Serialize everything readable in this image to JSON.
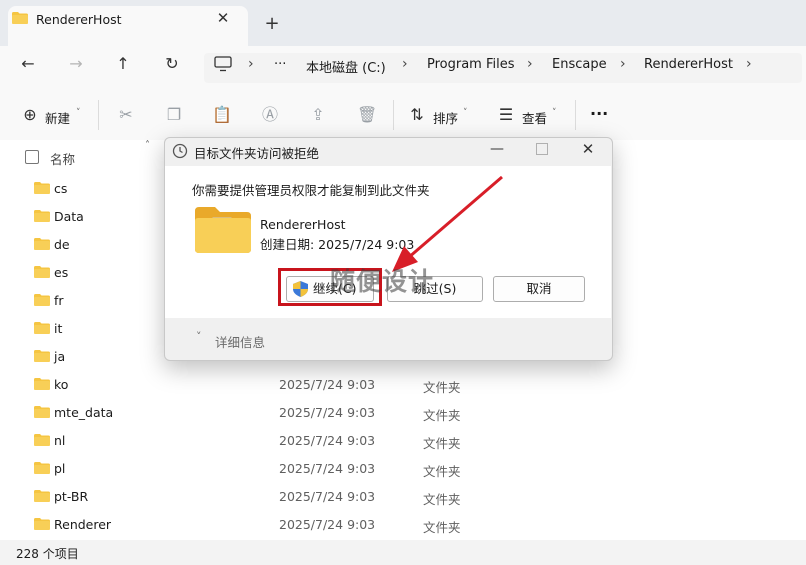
{
  "window": {
    "tab_title": "RendererHost",
    "close_glyph": "✕",
    "new_tab_glyph": "+"
  },
  "address_bar": {
    "overflow": "···",
    "crumbs": [
      "本地磁盘 (C:)",
      "Program Files",
      "Enscape",
      "RendererHost"
    ]
  },
  "toolbar": {
    "new_label": "新建",
    "sort_label": "排序",
    "view_label": "查看",
    "more": "···"
  },
  "list": {
    "name_header": "名称",
    "rows": [
      {
        "name": "cs",
        "date": "",
        "type": ""
      },
      {
        "name": "Data",
        "date": "",
        "type": ""
      },
      {
        "name": "de",
        "date": "",
        "type": ""
      },
      {
        "name": "es",
        "date": "",
        "type": ""
      },
      {
        "name": "fr",
        "date": "",
        "type": ""
      },
      {
        "name": "it",
        "date": "",
        "type": ""
      },
      {
        "name": "ja",
        "date": "",
        "type": ""
      },
      {
        "name": "ko",
        "date": "2025/7/24 9:03",
        "type": "文件夹"
      },
      {
        "name": "mte_data",
        "date": "2025/7/24 9:03",
        "type": "文件夹"
      },
      {
        "name": "nl",
        "date": "2025/7/24 9:03",
        "type": "文件夹"
      },
      {
        "name": "pl",
        "date": "2025/7/24 9:03",
        "type": "文件夹"
      },
      {
        "name": "pt-BR",
        "date": "2025/7/24 9:03",
        "type": "文件夹"
      },
      {
        "name": "Renderer",
        "date": "2025/7/24 9:03",
        "type": "文件夹"
      }
    ]
  },
  "status": {
    "item_count": "228 个项目"
  },
  "dialog": {
    "title": "目标文件夹访问被拒绝",
    "message": "你需要提供管理员权限才能复制到此文件夹",
    "file_name": "RendererHost",
    "file_created": "创建日期: 2025/7/24 9:03",
    "continue_label": "继续(C)",
    "skip_label": "跳过(S)",
    "cancel_label": "取消",
    "details_label": "详细信息"
  },
  "watermark": "随便设计",
  "colors": {
    "folder": "#f5c542",
    "highlight": "#c8141c",
    "arrow": "#d81e28"
  }
}
